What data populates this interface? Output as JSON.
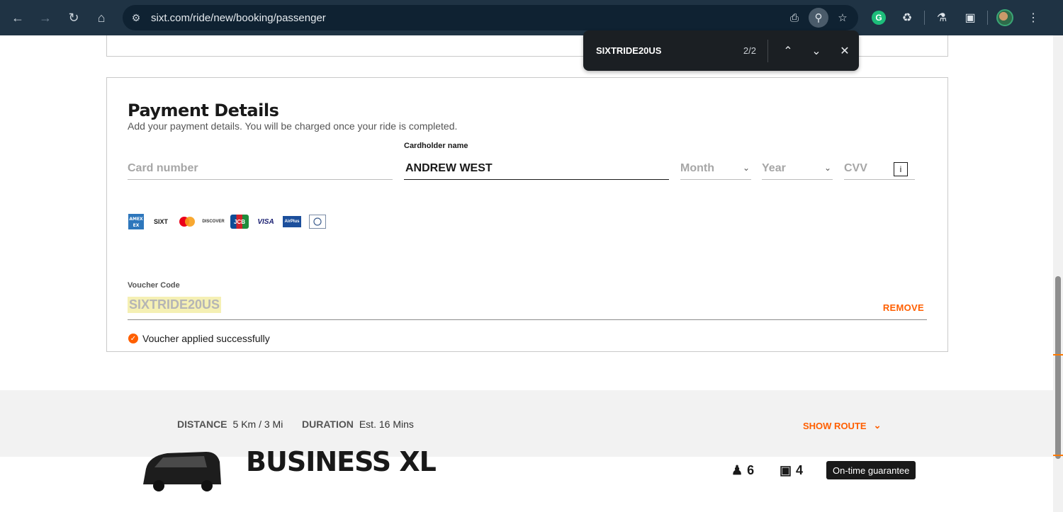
{
  "browser": {
    "url": "sixt.com/ride/new/booking/passenger",
    "icons": [
      "back-icon",
      "forward-icon",
      "reload-icon",
      "home-icon",
      "site-info-icon",
      "install-icon",
      "find-icon",
      "bookmark-star-icon",
      "grammarly-icon",
      "extensions-icon",
      "labs-icon",
      "lens-icon",
      "profile-avatar",
      "menu-icon"
    ]
  },
  "findbar": {
    "query": "SIXTRIDE20US",
    "count": "2/2"
  },
  "payment": {
    "title": "Payment Details",
    "subtitle": "Add your payment details. You will be charged once your ride is completed.",
    "card_number_placeholder": "Card number",
    "cardholder_label": "Cardholder name",
    "cardholder_value": "ANDREW WEST",
    "month_placeholder": "Month",
    "year_placeholder": "Year",
    "cvv_placeholder": "CVV",
    "cvv_info": "i",
    "card_brands": [
      "AMEX",
      "SIXT",
      "Mastercard",
      "DISCOVER",
      "JCB",
      "VISA",
      "AirPlus",
      "Diners Club"
    ],
    "voucher_label": "Voucher Code",
    "voucher_value": "SIXTRIDE20US",
    "remove_label": "REMOVE",
    "voucher_status": "Voucher applied successfully"
  },
  "route": {
    "distance_label": "DISTANCE",
    "distance_value": "5 Km / 3 Mi",
    "duration_label": "DURATION",
    "duration_value": "Est. 16 Mins",
    "show_route_label": "SHOW ROUTE"
  },
  "vehicle": {
    "name": "BUSINESS XL",
    "passengers": "6",
    "luggage": "4",
    "badge": "On-time guarantee"
  },
  "colors": {
    "accent": "#ff5f00",
    "chrome": "#1f3344",
    "findbar": "#1b1f23"
  }
}
